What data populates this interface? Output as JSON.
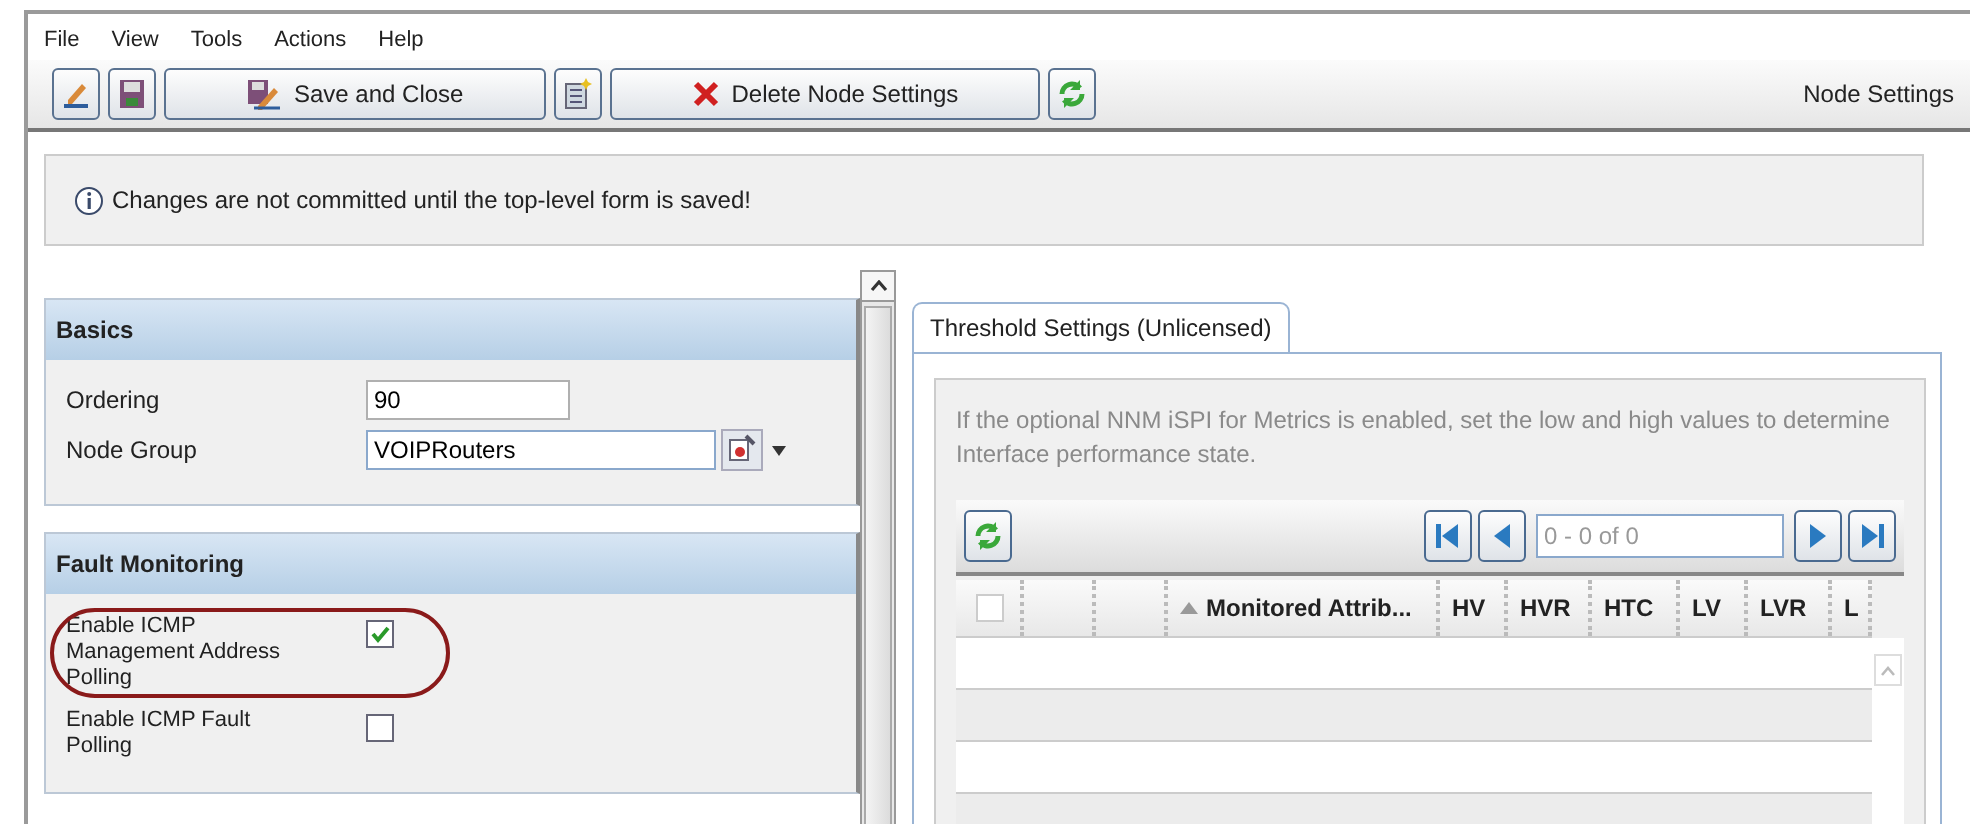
{
  "menu": [
    "File",
    "View",
    "Tools",
    "Actions",
    "Help"
  ],
  "toolbar": [
    {
      "kind": "icon"
    },
    {
      "kind": "icon"
    },
    {
      "kind": "labeled",
      "label": "Save and Close"
    },
    {
      "kind": "icon"
    },
    {
      "kind": "labeled",
      "label": "Delete Node Settings"
    },
    {
      "kind": "icon"
    }
  ],
  "window": {
    "title": "Node Settings"
  },
  "info": "Changes are not committed until the top-level form is saved!",
  "sections": [
    {
      "title": "Basics",
      "fields": [
        {
          "kind": "text",
          "label": "Ordering",
          "value": "90"
        },
        {
          "kind": "lookup",
          "label": "Node Group",
          "value": "VOIPRouters"
        }
      ]
    },
    {
      "title": "Fault Monitoring",
      "fields": [
        {
          "kind": "checkbox",
          "label": "Enable ICMP Management Address Polling",
          "checked": true,
          "highlighted": true
        },
        {
          "kind": "checkbox",
          "label": "Enable ICMP Fault Polling",
          "checked": false,
          "highlighted": false
        }
      ]
    }
  ],
  "tabs": [
    {
      "label": "Threshold Settings (Unlicensed)",
      "selected": true
    }
  ],
  "description": "If the optional NNM iSPI for Metrics is enabled, set the low and high values to determine Interface performance state.",
  "pager": {
    "placeholder": "0 - 0 of 0"
  },
  "table": {
    "columns": [
      {
        "kind": "check",
        "checked": false
      },
      {
        "kind": "blank"
      },
      {
        "kind": "blank"
      },
      {
        "kind": "sorted",
        "label": "Monitored Attrib..."
      },
      {
        "kind": "text",
        "label": "HV"
      },
      {
        "kind": "text",
        "label": "HVR"
      },
      {
        "kind": "text",
        "label": "HTC"
      },
      {
        "kind": "text",
        "label": "LV"
      },
      {
        "kind": "text",
        "label": "LVR"
      },
      {
        "kind": "text",
        "label": "L"
      }
    ]
  }
}
